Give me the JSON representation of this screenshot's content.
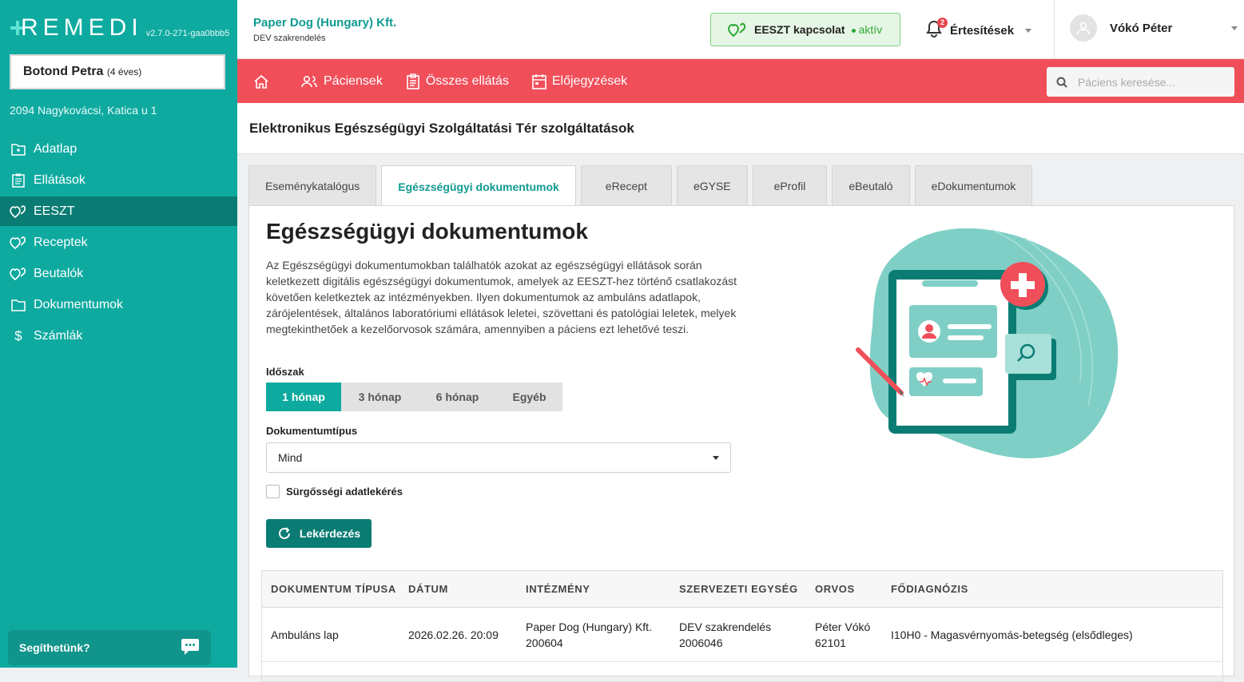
{
  "app": {
    "logo": "REMEDI",
    "version": "v2.7.0-271-gaa0bbb5"
  },
  "patient": {
    "name": "Botond Petra",
    "age": "(4 éves)",
    "address": "2094 Nagykovácsi, Katica u 1"
  },
  "sidebar": {
    "items": [
      {
        "label": "Adatlap",
        "icon": "folder-user-icon"
      },
      {
        "label": "Ellátások",
        "icon": "clipboard-icon"
      },
      {
        "label": "EESZT",
        "icon": "eeszt-hearts-icon"
      },
      {
        "label": "Receptek",
        "icon": "eeszt-hearts-icon"
      },
      {
        "label": "Beutalók",
        "icon": "eeszt-hearts-icon"
      },
      {
        "label": "Dokumentumok",
        "icon": "folder-icon"
      },
      {
        "label": "Számlák",
        "icon": "dollar-icon"
      }
    ],
    "active": "EESZT",
    "help_label": "Segíthetünk?"
  },
  "header": {
    "org_name": "Paper Dog (Hungary) Kft.",
    "org_sub": "DEV szakrendelés",
    "eeszt_label": "EESZT kapcsolat",
    "eeszt_status": "aktív",
    "notifications_label": "Értesítések",
    "notifications_count": "2",
    "user_name": "Vókó Péter"
  },
  "nav": {
    "items": [
      "Páciensek",
      "Összes ellátás",
      "Előjegyzések"
    ],
    "search_placeholder": "Páciens keresése..."
  },
  "page": {
    "title": "Elektronikus Egészségügyi Szolgáltatási Tér szolgáltatások"
  },
  "tabs": {
    "items": [
      "Eseménykatalógus",
      "Egészségügyi dokumentumok",
      "eRecept",
      "eGYSE",
      "eProfil",
      "eBeutaló",
      "eDokumentumok"
    ],
    "active": "Egészségügyi dokumentumok"
  },
  "panel": {
    "title": "Egészségügyi dokumentumok",
    "description": "Az Egészségügyi dokumentumokban találhatók azokat az egészségügyi ellátások során keletkezett digitális egészségügyi dokumentumok, amelyek az EESZT-hez történő csatlakozást követően keletkeztek az intézményekben. Ilyen dokumentumok az ambuláns adatlapok, zárójelentések, általános laboratóriumi ellátások leletei, szövettani és patológiai leletek, melyek megtekinthetőek a kezelőorvosok számára, amennyiben a páciens ezt lehetővé teszi.",
    "period_label": "Időszak",
    "period_options": [
      "1 hónap",
      "3 hónap",
      "6 hónap",
      "Egyéb"
    ],
    "period_selected": "1 hónap",
    "doctype_label": "Dokumentumtípus",
    "doctype_value": "Mind",
    "emergency_label": "Sürgősségi adatlekérés",
    "emergency_checked": false,
    "query_button": "Lekérdezés"
  },
  "table": {
    "headers": [
      "DOKUMENTUM TÍPUSA",
      "DÁTUM",
      "INTÉZMÉNY",
      "SZERVEZETI EGYSÉG",
      "ORVOS",
      "FŐDIAGNÓZIS"
    ],
    "rows": [
      {
        "type": "Ambuláns lap",
        "date": "2026.02.26. 20:09",
        "institution": "Paper Dog (Hungary) Kft.",
        "institution_code": "200604",
        "unit": "DEV szakrendelés",
        "unit_code": "2006046",
        "doctor": "Péter Vókó",
        "doctor_code": "62101",
        "diagnosis": "I10H0 - Magasvérnyomás-betegség (elsődleges)"
      }
    ]
  },
  "colors": {
    "sidebar": "#0eaaa0",
    "sidebar_active": "#0b7c74",
    "navbar": "#f04f5a",
    "accent": "#0f9b91",
    "button": "#0b7c74"
  }
}
